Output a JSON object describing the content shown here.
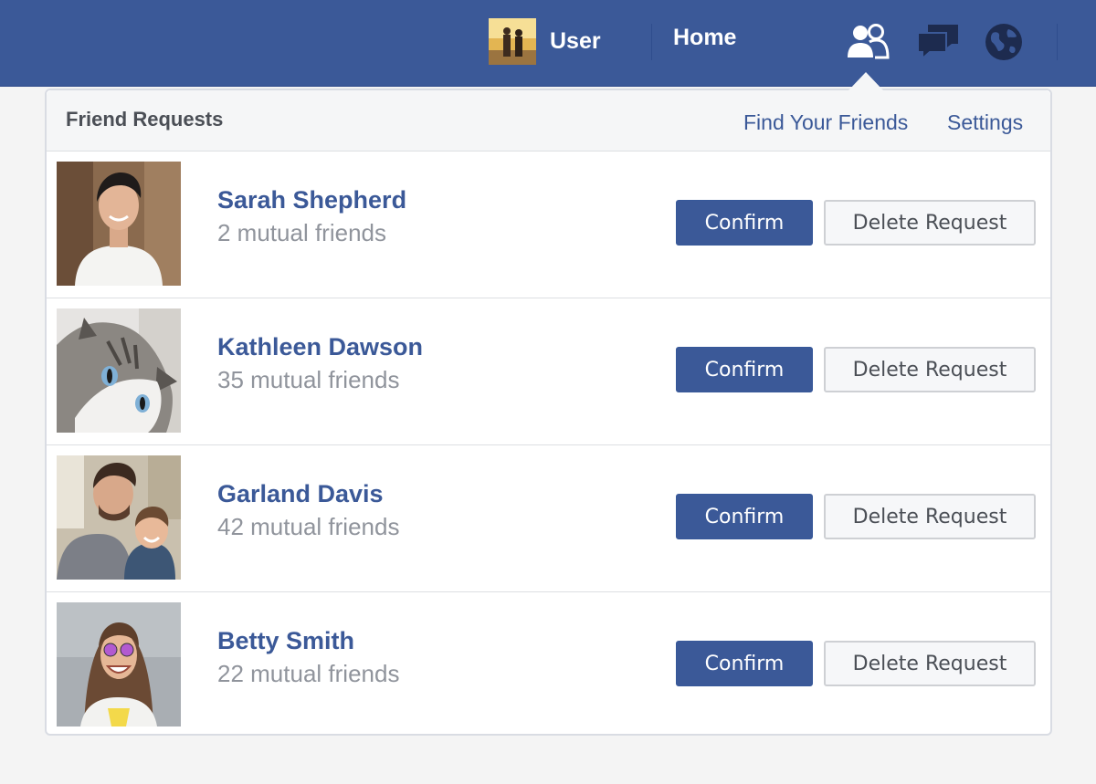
{
  "navbar": {
    "user_label": "User",
    "home_label": "Home",
    "icons": [
      "friends-icon",
      "messages-icon",
      "globe-icon"
    ],
    "bg_color": "#3b5998"
  },
  "friend_requests": {
    "title": "Friend Requests",
    "find_friends_label": "Find Your Friends",
    "settings_label": "Settings",
    "requests": [
      {
        "name": "Sarah Shepherd",
        "mutual": "2 mutual friends",
        "confirm_label": "Confirm",
        "delete_label": "Delete Request"
      },
      {
        "name": "Kathleen Dawson",
        "mutual": "35 mutual friends",
        "confirm_label": "Confirm",
        "delete_label": "Delete Request"
      },
      {
        "name": "Garland Davis",
        "mutual": "42 mutual friends",
        "confirm_label": "Confirm",
        "delete_label": "Delete Request"
      },
      {
        "name": "Betty Smith",
        "mutual": "22 mutual friends",
        "confirm_label": "Confirm",
        "delete_label": "Delete Request"
      }
    ]
  },
  "colors": {
    "brand": "#3b5998",
    "muted_text": "#90949c",
    "header_bg": "#f5f6f7"
  }
}
